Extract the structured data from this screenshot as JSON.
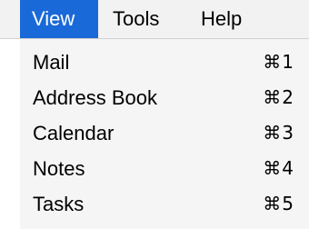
{
  "menubar": {
    "items": [
      {
        "label": "View",
        "active": true
      },
      {
        "label": "Tools",
        "active": false
      },
      {
        "label": "Help",
        "active": false
      }
    ]
  },
  "view_menu": {
    "items": [
      {
        "label": "Mail",
        "shortcut": "⌘1"
      },
      {
        "label": "Address Book",
        "shortcut": "⌘2"
      },
      {
        "label": "Calendar",
        "shortcut": "⌘3"
      },
      {
        "label": "Notes",
        "shortcut": "⌘4"
      },
      {
        "label": "Tasks",
        "shortcut": "⌘5"
      }
    ]
  },
  "colors": {
    "menubar_bg": "#f2f2f2",
    "active_bg": "#1a69d8",
    "active_text": "#ffffff",
    "dropdown_bg": "#f5f5f5"
  }
}
